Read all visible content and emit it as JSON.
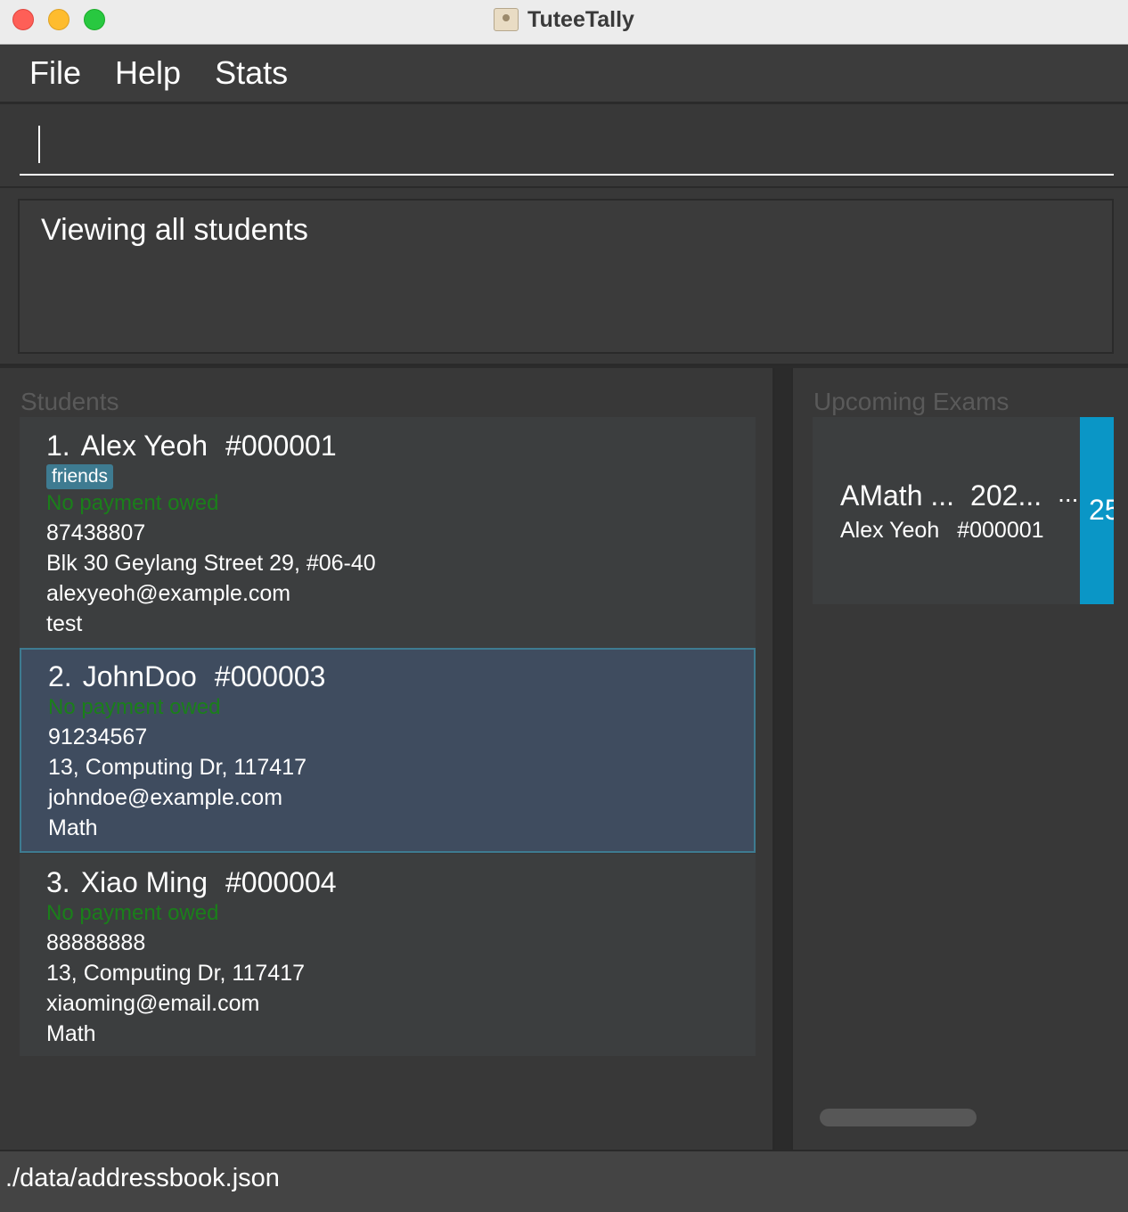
{
  "window": {
    "title": "TuteeTally"
  },
  "menu": {
    "file": "File",
    "help": "Help",
    "stats": "Stats"
  },
  "command": {
    "value": ""
  },
  "result": {
    "text": "Viewing all students"
  },
  "students": {
    "heading": "Students",
    "items": [
      {
        "index": "1.",
        "name": "Alex Yeoh",
        "id": "#000001",
        "tag": "friends",
        "payment": "No payment owed",
        "phone": "87438807",
        "address": "Blk 30 Geylang Street 29, #06-40",
        "email": "alexyeoh@example.com",
        "subject": "test"
      },
      {
        "index": "2.",
        "name": "JohnDoo",
        "id": "#000003",
        "payment": "No payment owed",
        "phone": "91234567",
        "address": "13, Computing Dr, 117417",
        "email": "johndoe@example.com",
        "subject": "Math"
      },
      {
        "index": "3.",
        "name": "Xiao Ming",
        "id": "#000004",
        "payment": "No payment owed",
        "phone": "88888888",
        "address": "13, Computing Dr, 117417",
        "email": "xiaoming@email.com",
        "subject": "Math"
      }
    ]
  },
  "exams": {
    "heading": "Upcoming Exams",
    "items": [
      {
        "name": "AMath ...",
        "date": "202...",
        "more": "...",
        "student": "Alex Yeoh",
        "student_id": "#000001",
        "badge": "25"
      }
    ]
  },
  "status": {
    "path": "./data/addressbook.json"
  },
  "colors": {
    "accent": "#0a96c6",
    "selected_bg": "#3f4c5f",
    "selected_border": "#3e7b91",
    "payment_ok": "#1a7f1a",
    "tag_bg": "#3e7b91"
  }
}
